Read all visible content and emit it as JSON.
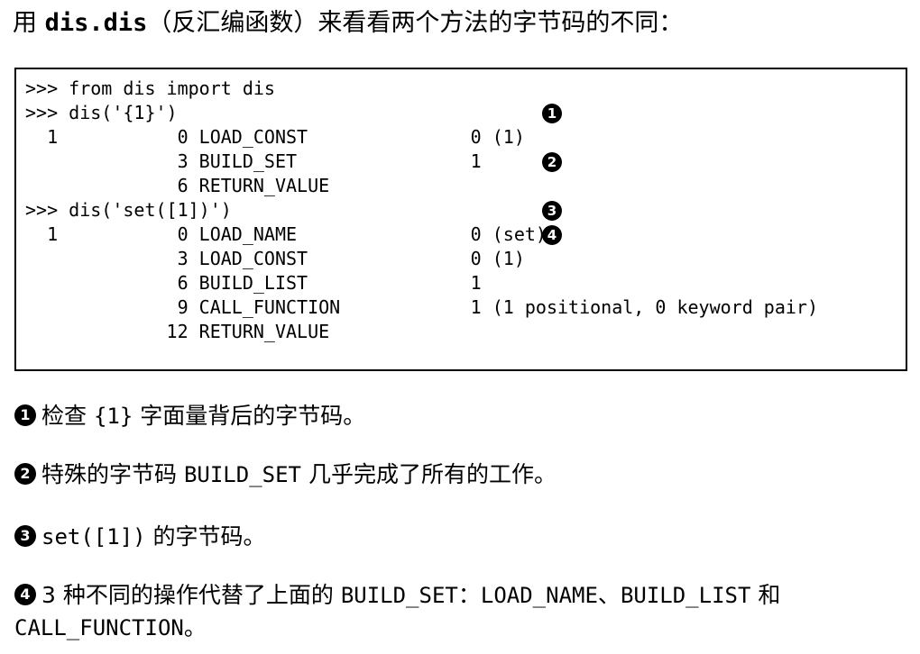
{
  "intro": {
    "prefix": "用 ",
    "code": "dis.dis",
    "suffix": "（反汇编函数）来看看两个方法的字节码的不同："
  },
  "code_listing": [
    ">>> from dis import dis",
    ">>> dis('{1}')",
    "  1           0 LOAD_CONST               0 (1)",
    "              3 BUILD_SET                1",
    "              6 RETURN_VALUE",
    ">>> dis('set([1])')",
    "  1           0 LOAD_NAME                0 (set)",
    "              3 LOAD_CONST               0 (1)",
    "              6 BUILD_LIST               1",
    "              9 CALL_FUNCTION            1 (1 positional, 0 keyword pair)",
    "             12 RETURN_VALUE"
  ],
  "callouts": [
    "1",
    "2",
    "3",
    "4"
  ],
  "notes": [
    {
      "number": "1",
      "before": "检查 ",
      "code": "{1}",
      "after": " 字面量背后的字节码。"
    },
    {
      "number": "2",
      "before": "特殊的字节码 ",
      "code": "BUILD_SET",
      "after": " 几乎完成了所有的工作。"
    },
    {
      "number": "3",
      "before": "",
      "code": "set([1])",
      "after": " 的字节码。"
    },
    {
      "number": "4",
      "line1_before": "3 种不同的操作代替了上面的 ",
      "code1": "BUILD_SET",
      "sep1": "：",
      "code2": "LOAD_NAME",
      "sep2": "、",
      "code3": "BUILD_LIST",
      "sep3": " 和",
      "code4": "CALL_FUNCTION",
      "end": "。"
    }
  ]
}
